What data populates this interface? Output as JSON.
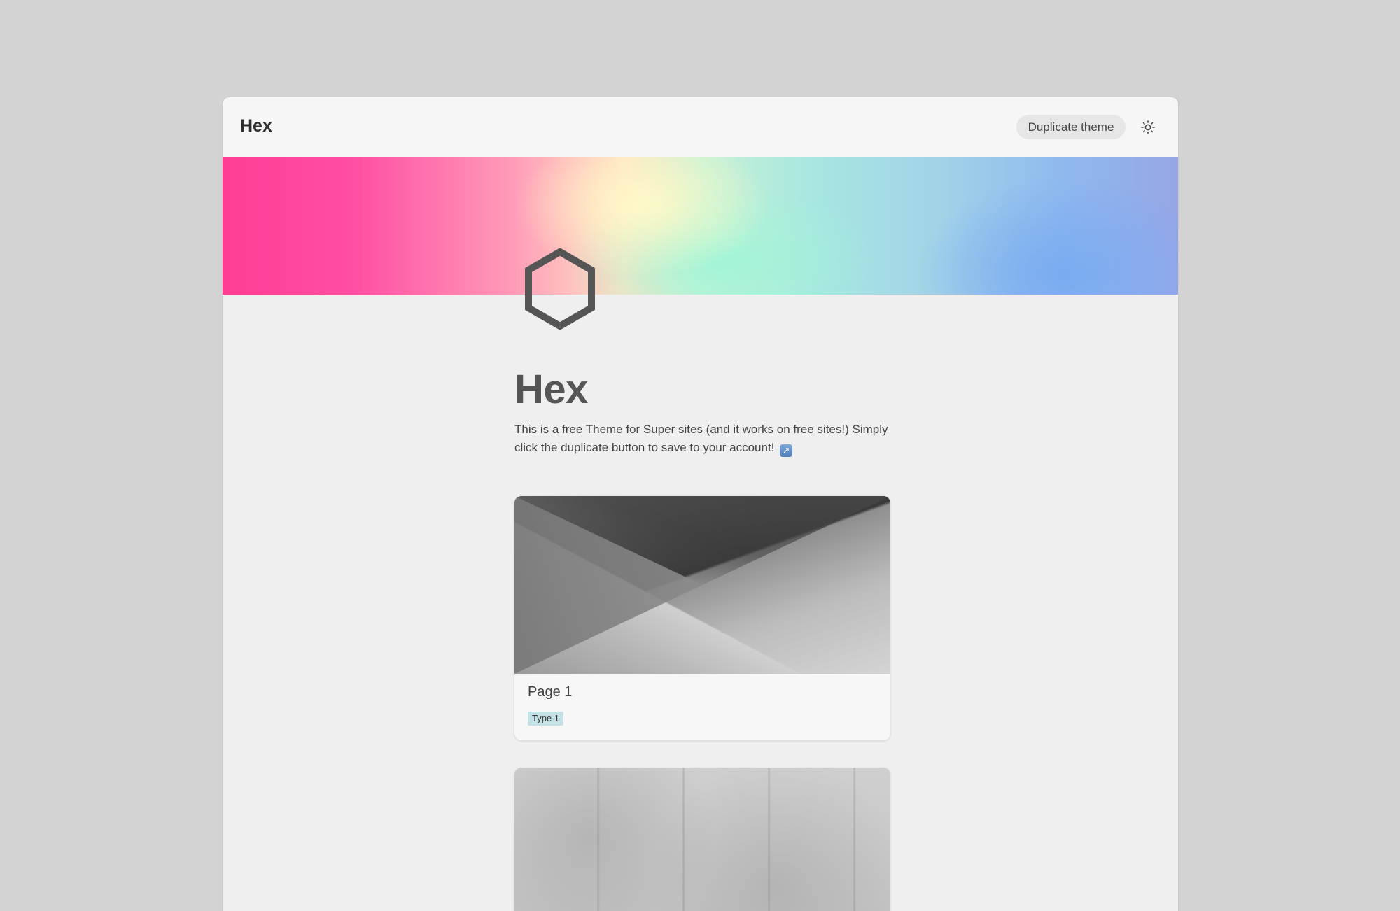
{
  "header": {
    "site_title": "Hex",
    "duplicate_button_label": "Duplicate theme",
    "theme_toggle_icon": "sun-icon"
  },
  "hero": {
    "banner_colors": [
      "#ff3d95",
      "#ff9ab8",
      "#ffe3c2",
      "#c8f2d4",
      "#a2d3e8",
      "#96a6e6"
    ],
    "logo_icon": "hexagon-icon",
    "logo_color": "#555555"
  },
  "main": {
    "heading": "Hex",
    "description": "This is a free Theme for Super sites (and it works on free sites!) Simply click the duplicate button to save to your account!",
    "description_emoji": "↗"
  },
  "cards": [
    {
      "title": "Page 1",
      "tag": "Type 1",
      "tag_color": "#c4e1e6"
    },
    {
      "title": "",
      "tag": ""
    }
  ]
}
